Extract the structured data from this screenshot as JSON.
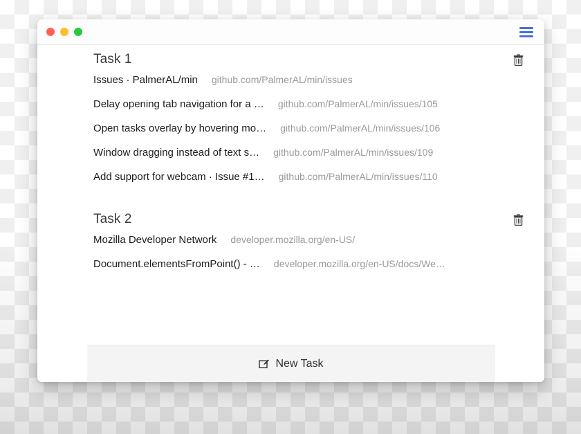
{
  "window": {
    "titlebar": {
      "traffic_lights": [
        {
          "name": "close",
          "color": "#ff5f57"
        },
        {
          "name": "minimize",
          "color": "#ffbd2e"
        },
        {
          "name": "zoom",
          "color": "#28c940"
        }
      ],
      "menu_icon": "hamburger-icon",
      "menu_color": "#4a6ee0"
    },
    "tasks": [
      {
        "title": "Task 1",
        "delete_icon": "trash-icon",
        "rows": [
          {
            "title": "Issues · PalmerAL/min",
            "url": "github.com/PalmerAL/min/issues"
          },
          {
            "title": "Delay opening tab navigation for a …",
            "url": "github.com/PalmerAL/min/issues/105"
          },
          {
            "title": "Open tasks overlay by hovering mo…",
            "url": "github.com/PalmerAL/min/issues/106"
          },
          {
            "title": "Window dragging instead of text s…",
            "url": "github.com/PalmerAL/min/issues/109"
          },
          {
            "title": "Add support for webcam · Issue #1…",
            "url": "github.com/PalmerAL/min/issues/110"
          }
        ]
      },
      {
        "title": "Task 2",
        "delete_icon": "trash-icon",
        "rows": [
          {
            "title": "Mozilla Developer Network",
            "url": "developer.mozilla.org/en-US/"
          },
          {
            "title": "Document.elementsFromPoint() - …",
            "url": "developer.mozilla.org/en-US/docs/We…"
          }
        ]
      }
    ],
    "footer": {
      "new_task_label": "New Task",
      "new_task_icon": "edit-square-icon"
    }
  }
}
